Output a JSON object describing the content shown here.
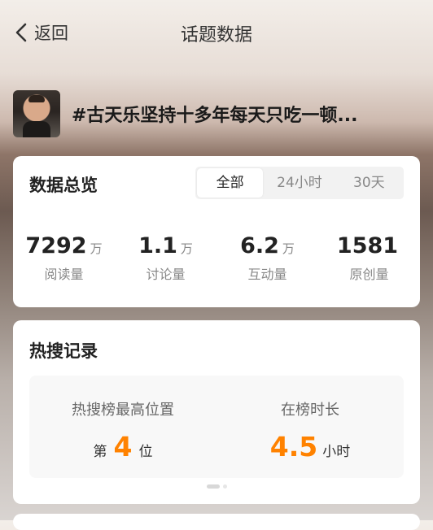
{
  "header": {
    "back_label": "返回",
    "title": "话题数据"
  },
  "topic": {
    "title": "#古天乐坚持十多年每天只吃一顿..."
  },
  "overview": {
    "title": "数据总览",
    "tabs": [
      {
        "label": "全部",
        "active": true
      },
      {
        "label": "24小时",
        "active": false
      },
      {
        "label": "30天",
        "active": false
      }
    ],
    "stats": [
      {
        "value": "7292",
        "unit": "万",
        "label": "阅读量"
      },
      {
        "value": "1.1",
        "unit": "万",
        "label": "讨论量"
      },
      {
        "value": "6.2",
        "unit": "万",
        "label": "互动量"
      },
      {
        "value": "1581",
        "unit": "",
        "label": "原创量"
      }
    ]
  },
  "hot_search": {
    "title": "热搜记录",
    "peak": {
      "label": "热搜榜最高位置",
      "prefix": "第",
      "value": "4",
      "suffix": "位"
    },
    "duration": {
      "label": "在榜时长",
      "value": "4.5",
      "suffix": "小时"
    }
  },
  "colors": {
    "accent": "#ff8200"
  }
}
